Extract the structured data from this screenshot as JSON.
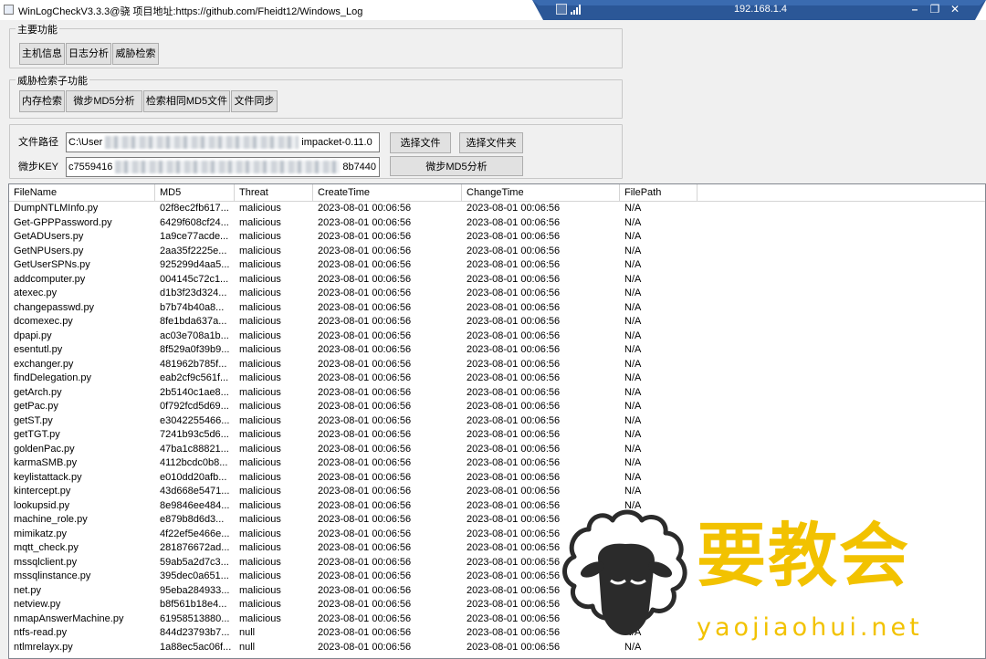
{
  "window": {
    "title": "WinLogCheckV3.3.3@骁 项目地址:https://github.com/Fheidt12/Windows_Log",
    "remote_ip": "192.168.1.4"
  },
  "main_functions": {
    "label": "主要功能",
    "buttons": [
      "主机信息",
      "日志分析",
      "威胁检索"
    ]
  },
  "sub_functions": {
    "label": "威胁检索子功能",
    "buttons": [
      "内存检索",
      "微步MD5分析",
      "检索相同MD5文件",
      "文件同步"
    ]
  },
  "file_panel": {
    "path_label": "文件路径",
    "path_prefix": "C:\\User",
    "path_suffix": "impacket-0.11.0",
    "key_label": "微步KEY",
    "key_prefix": "c7559416",
    "key_suffix": "8b7440",
    "choose_file": "选择文件",
    "choose_folder": "选择文件夹",
    "md5_analyze": "微步MD5分析"
  },
  "table": {
    "columns": [
      "FileName",
      "MD5",
      "Threat",
      "CreateTime",
      "ChangeTime",
      "FilePath"
    ],
    "rows": [
      [
        "DumpNTLMInfo.py",
        "02f8ec2fb617...",
        "malicious",
        "2023-08-01 00:06:56",
        "2023-08-01 00:06:56",
        "N/A"
      ],
      [
        "Get-GPPPassword.py",
        "6429f608cf24...",
        "malicious",
        "2023-08-01 00:06:56",
        "2023-08-01 00:06:56",
        "N/A"
      ],
      [
        "GetADUsers.py",
        "1a9ce77acde...",
        "malicious",
        "2023-08-01 00:06:56",
        "2023-08-01 00:06:56",
        "N/A"
      ],
      [
        "GetNPUsers.py",
        "2aa35f2225e...",
        "malicious",
        "2023-08-01 00:06:56",
        "2023-08-01 00:06:56",
        "N/A"
      ],
      [
        "GetUserSPNs.py",
        "925299d4aa5...",
        "malicious",
        "2023-08-01 00:06:56",
        "2023-08-01 00:06:56",
        "N/A"
      ],
      [
        "addcomputer.py",
        "004145c72c1...",
        "malicious",
        "2023-08-01 00:06:56",
        "2023-08-01 00:06:56",
        "N/A"
      ],
      [
        "atexec.py",
        "d1b3f23d324...",
        "malicious",
        "2023-08-01 00:06:56",
        "2023-08-01 00:06:56",
        "N/A"
      ],
      [
        "changepasswd.py",
        "b7b74b40a8...",
        "malicious",
        "2023-08-01 00:06:56",
        "2023-08-01 00:06:56",
        "N/A"
      ],
      [
        "dcomexec.py",
        "8fe1bda637a...",
        "malicious",
        "2023-08-01 00:06:56",
        "2023-08-01 00:06:56",
        "N/A"
      ],
      [
        "dpapi.py",
        "ac03e708a1b...",
        "malicious",
        "2023-08-01 00:06:56",
        "2023-08-01 00:06:56",
        "N/A"
      ],
      [
        "esentutl.py",
        "8f529a0f39b9...",
        "malicious",
        "2023-08-01 00:06:56",
        "2023-08-01 00:06:56",
        "N/A"
      ],
      [
        "exchanger.py",
        "481962b785f...",
        "malicious",
        "2023-08-01 00:06:56",
        "2023-08-01 00:06:56",
        "N/A"
      ],
      [
        "findDelegation.py",
        "eab2cf9c561f...",
        "malicious",
        "2023-08-01 00:06:56",
        "2023-08-01 00:06:56",
        "N/A"
      ],
      [
        "getArch.py",
        "2b5140c1ae8...",
        "malicious",
        "2023-08-01 00:06:56",
        "2023-08-01 00:06:56",
        "N/A"
      ],
      [
        "getPac.py",
        "0f792fcd5d69...",
        "malicious",
        "2023-08-01 00:06:56",
        "2023-08-01 00:06:56",
        "N/A"
      ],
      [
        "getST.py",
        "e3042255466...",
        "malicious",
        "2023-08-01 00:06:56",
        "2023-08-01 00:06:56",
        "N/A"
      ],
      [
        "getTGT.py",
        "7241b93c5d6...",
        "malicious",
        "2023-08-01 00:06:56",
        "2023-08-01 00:06:56",
        "N/A"
      ],
      [
        "goldenPac.py",
        "47ba1c88821...",
        "malicious",
        "2023-08-01 00:06:56",
        "2023-08-01 00:06:56",
        "N/A"
      ],
      [
        "karmaSMB.py",
        "4112bcdc0b8...",
        "malicious",
        "2023-08-01 00:06:56",
        "2023-08-01 00:06:56",
        "N/A"
      ],
      [
        "keylistattack.py",
        "e010dd20afb...",
        "malicious",
        "2023-08-01 00:06:56",
        "2023-08-01 00:06:56",
        "N/A"
      ],
      [
        "kintercept.py",
        "43d668e5471...",
        "malicious",
        "2023-08-01 00:06:56",
        "2023-08-01 00:06:56",
        "N/A"
      ],
      [
        "lookupsid.py",
        "8e9846ee484...",
        "malicious",
        "2023-08-01 00:06:56",
        "2023-08-01 00:06:56",
        "N/A"
      ],
      [
        "machine_role.py",
        "e879b8d6d3...",
        "malicious",
        "2023-08-01 00:06:56",
        "2023-08-01 00:06:56",
        "N/A"
      ],
      [
        "mimikatz.py",
        "4f22ef5e466e...",
        "malicious",
        "2023-08-01 00:06:56",
        "2023-08-01 00:06:56",
        "N/A"
      ],
      [
        "mqtt_check.py",
        "281876672ad...",
        "malicious",
        "2023-08-01 00:06:56",
        "2023-08-01 00:06:56",
        "N/A"
      ],
      [
        "mssqlclient.py",
        "59ab5a2d7c3...",
        "malicious",
        "2023-08-01 00:06:56",
        "2023-08-01 00:06:56",
        "N/A"
      ],
      [
        "mssqlinstance.py",
        "395dec0a651...",
        "malicious",
        "2023-08-01 00:06:56",
        "2023-08-01 00:06:56",
        "N/A"
      ],
      [
        "net.py",
        "95eba284933...",
        "malicious",
        "2023-08-01 00:06:56",
        "2023-08-01 00:06:56",
        "N/A"
      ],
      [
        "netview.py",
        "b8f561b18e4...",
        "malicious",
        "2023-08-01 00:06:56",
        "2023-08-01 00:06:56",
        "N/A"
      ],
      [
        "nmapAnswerMachine.py",
        "61958513880...",
        "malicious",
        "2023-08-01 00:06:56",
        "2023-08-01 00:06:56",
        "N/A"
      ],
      [
        "ntfs-read.py",
        "844d23793b7...",
        "null",
        "2023-08-01 00:06:56",
        "2023-08-01 00:06:56",
        "N/A"
      ],
      [
        "ntlmrelayx.py",
        "1a88ec5ac06f...",
        "null",
        "2023-08-01 00:06:56",
        "2023-08-01 00:06:56",
        "N/A"
      ]
    ]
  },
  "watermark": {
    "text": "要教会",
    "url": "yaojiaohui.net",
    "color": "#f2c200"
  }
}
